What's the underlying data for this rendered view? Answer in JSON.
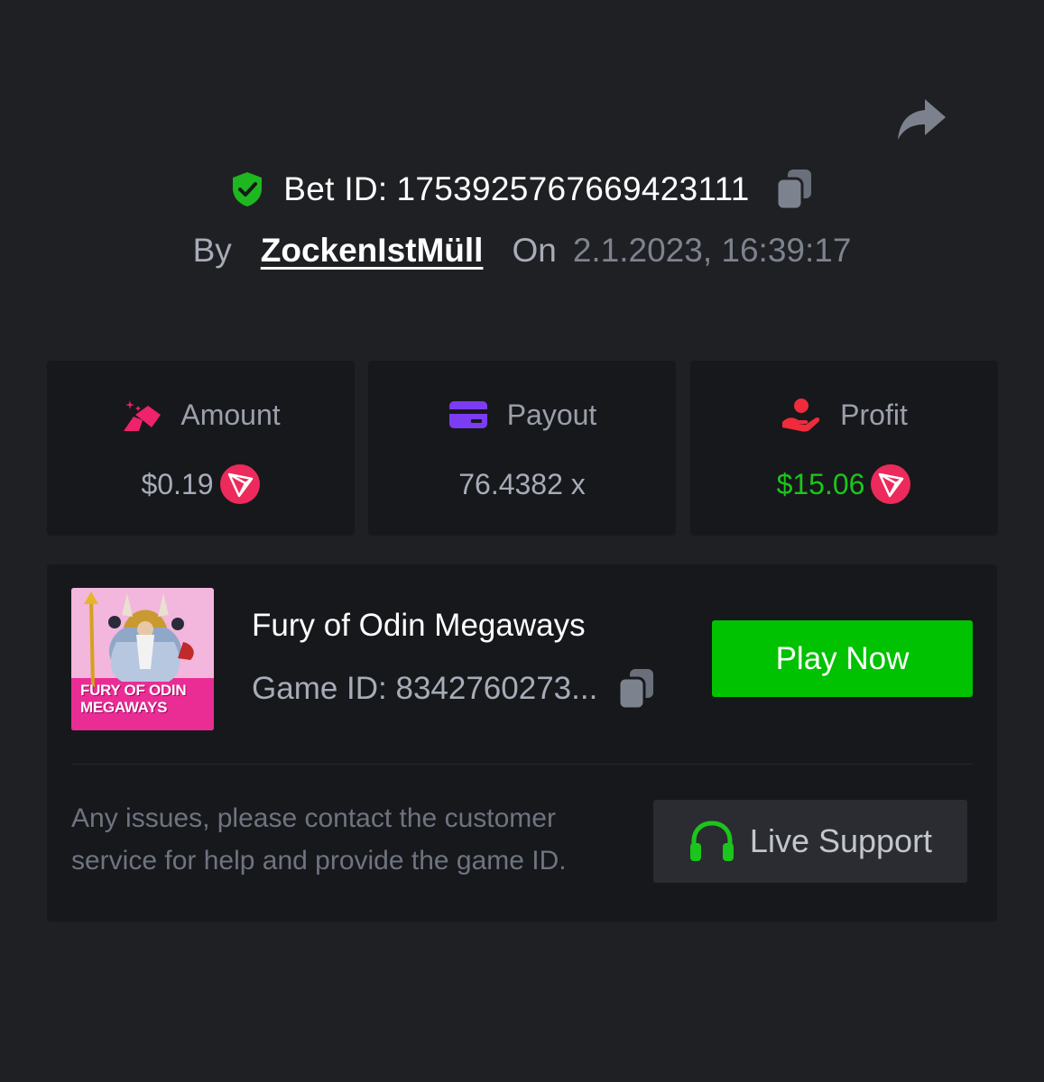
{
  "bet": {
    "label": "Bet ID:",
    "id": "1753925767669423111",
    "by_label": "By",
    "username": "ZockenIstMüll",
    "on_label": "On",
    "datetime": "2.1.2023, 16:39:17"
  },
  "stats": {
    "amount": {
      "label": "Amount",
      "value": "$0.19",
      "icon": "coins-icon",
      "currency_icon": "tron-icon"
    },
    "payout": {
      "label": "Payout",
      "value": "76.4382 x",
      "icon": "card-icon"
    },
    "profit": {
      "label": "Profit",
      "value": "$15.06",
      "icon": "hand-user-icon",
      "currency_icon": "tron-icon"
    }
  },
  "game": {
    "name": "Fury of Odin Megaways",
    "id_text": "Game ID: 8342760273...",
    "thumbnail_title_line1": "FURY OF ODIN",
    "thumbnail_title_line2": "MEGAWAYS",
    "play_label": "Play Now"
  },
  "support": {
    "help_text": "Any issues, please contact the customer service for help and provide the game ID.",
    "button_label": "Live Support"
  },
  "colors": {
    "background": "#1f2024",
    "card": "#17181b",
    "accent_green": "#00c200",
    "profit_green": "#1bc51b",
    "shield_green": "#1fb71f",
    "tron_red": "#ec2a5b",
    "amount_pink": "#f0226b",
    "payout_purple": "#7c3cf3",
    "profit_red": "#ee2c3c"
  }
}
